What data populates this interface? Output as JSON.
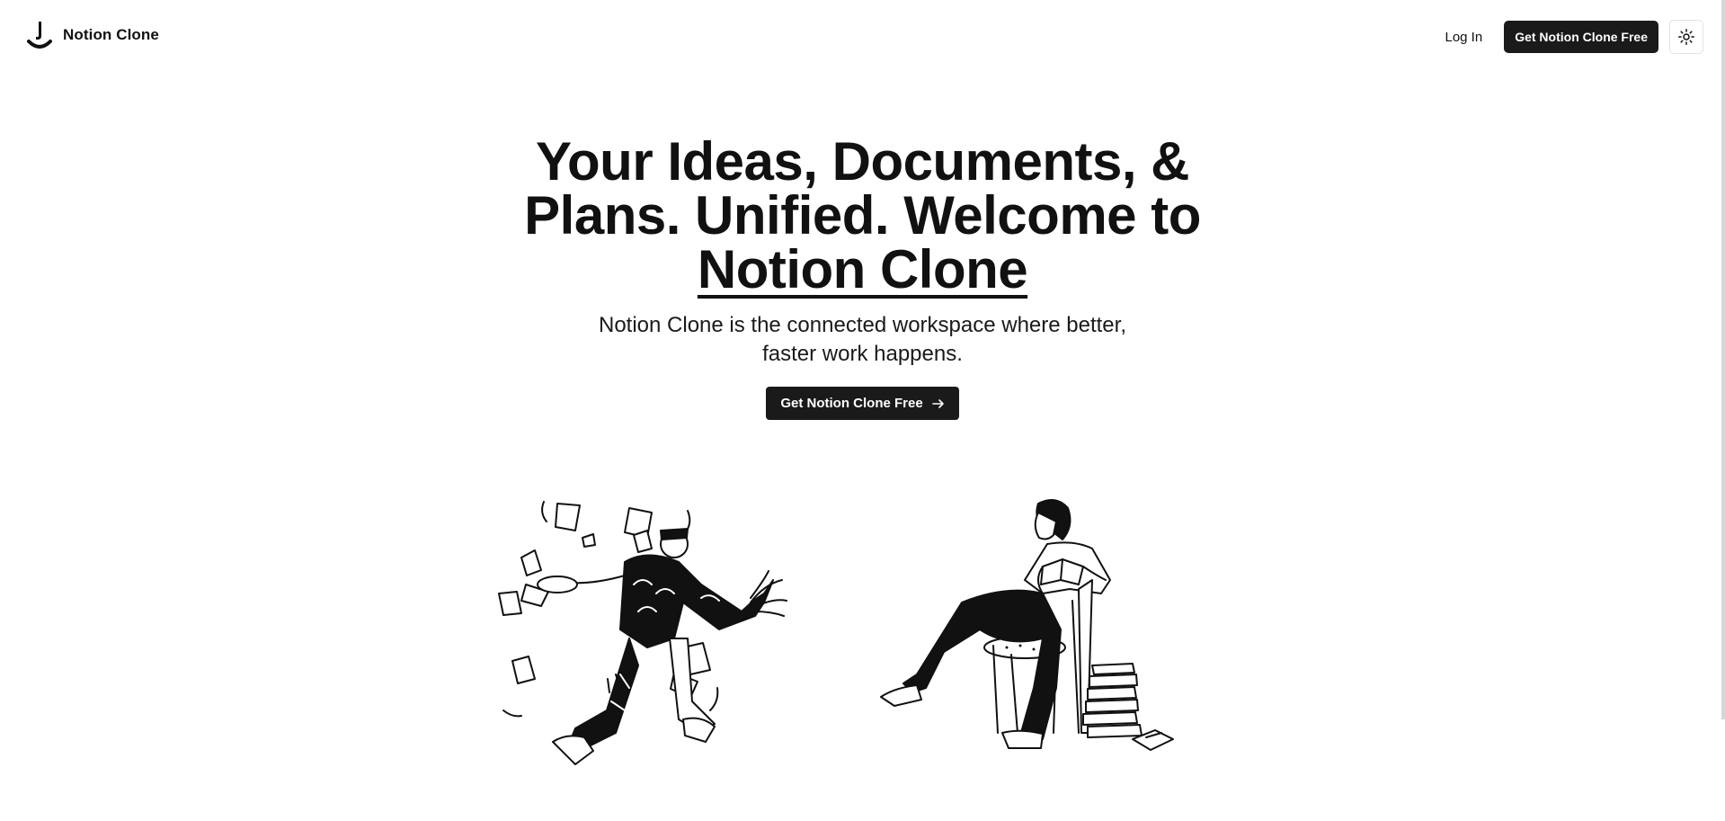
{
  "header": {
    "brand_name": "Notion Clone",
    "login_label": "Log In",
    "cta_label": "Get Notion Clone Free",
    "theme_icon": "sun-icon"
  },
  "hero": {
    "title_part1": "Your Ideas, Documents, & Plans. Unified. Welcome to ",
    "title_part2": "Notion Clone",
    "subtitle": "Notion Clone is the connected workspace where better, faster work happens.",
    "cta_label": "Get Notion Clone Free",
    "cta_icon": "arrow-right-icon"
  },
  "illustrations": {
    "left": "person-juggling-papers-illustration",
    "right": "person-reading-in-chair-illustration"
  },
  "colors": {
    "primary_dark": "#1a1a1a",
    "text": "#111111",
    "background": "#ffffff",
    "border": "#e2e2e2"
  }
}
